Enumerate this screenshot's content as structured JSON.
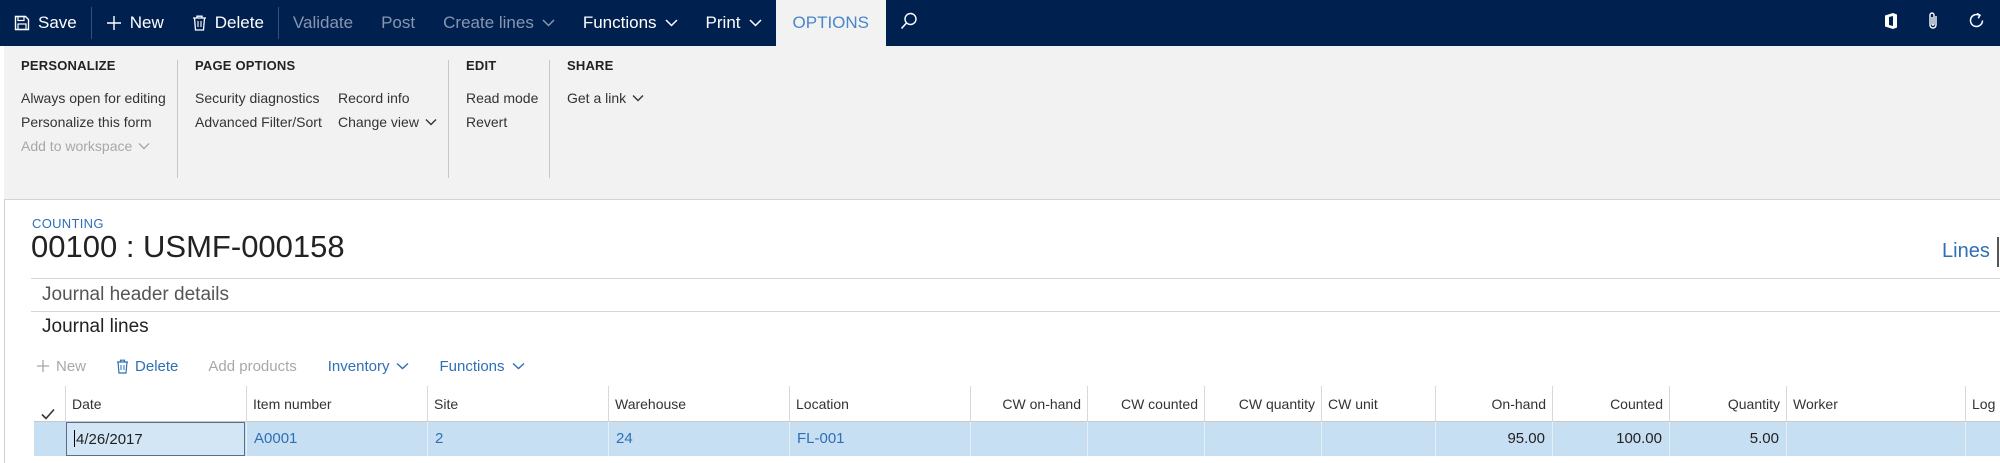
{
  "topbar": {
    "save": "Save",
    "new": "New",
    "delete": "Delete",
    "validate": "Validate",
    "post": "Post",
    "create_lines": "Create lines",
    "functions": "Functions",
    "print": "Print",
    "options": "OPTIONS"
  },
  "ribbon": {
    "personalize": {
      "heading": "PERSONALIZE",
      "always_open": "Always open for editing",
      "personalize_form": "Personalize this form",
      "add_workspace": "Add to workspace"
    },
    "page_options": {
      "heading": "PAGE OPTIONS",
      "security_diagnostics": "Security diagnostics",
      "advanced_filter": "Advanced Filter/Sort",
      "record_info": "Record info",
      "change_view": "Change view"
    },
    "edit": {
      "heading": "EDIT",
      "read_mode": "Read mode",
      "revert": "Revert"
    },
    "share": {
      "heading": "SHARE",
      "get_link": "Get a link"
    }
  },
  "page": {
    "caption": "COUNTING",
    "title": "00100 : USMF-000158",
    "lines_link": "Lines",
    "header_details": "Journal header details",
    "journal_lines": "Journal lines"
  },
  "grid_toolbar": {
    "new": "New",
    "delete": "Delete",
    "add_products": "Add products",
    "inventory": "Inventory",
    "functions": "Functions"
  },
  "grid": {
    "columns": {
      "date": "Date",
      "item_number": "Item number",
      "site": "Site",
      "warehouse": "Warehouse",
      "location": "Location",
      "cw_on_hand": "CW on-hand",
      "cw_counted": "CW counted",
      "cw_quantity": "CW quantity",
      "cw_unit": "CW unit",
      "on_hand": "On-hand",
      "counted": "Counted",
      "quantity": "Quantity",
      "worker": "Worker",
      "log": "Log"
    },
    "row": {
      "date": "4/26/2017",
      "item_number": "A0001",
      "site": "2",
      "warehouse": "24",
      "location": "FL-001",
      "cw_on_hand": "",
      "cw_counted": "",
      "cw_quantity": "",
      "cw_unit": "",
      "on_hand": "95.00",
      "counted": "100.00",
      "quantity": "5.00",
      "worker": "",
      "log": ""
    }
  },
  "colors": {
    "nav_bar": "#002050",
    "ribbon_bg": "#f2f2f2",
    "link_blue": "#2f6fb5",
    "selected_row": "#c7dff3"
  },
  "icons": [
    "save-icon",
    "plus-icon",
    "trash-icon",
    "chevron-down-icon",
    "search-icon",
    "office-icon",
    "attachment-icon",
    "refresh-icon",
    "check-icon"
  ]
}
